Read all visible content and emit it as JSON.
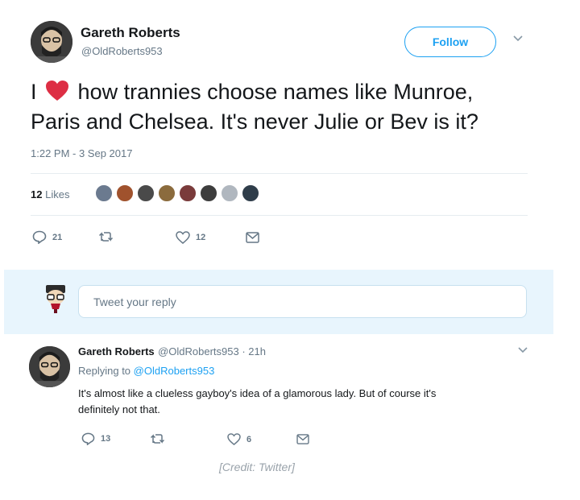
{
  "tweet": {
    "author_name": "Gareth Roberts",
    "author_handle": "@OldRoberts953",
    "follow_label": "Follow",
    "text_prefix": "I",
    "text_line1_rest": "how trannies choose names like Munroe,",
    "text_line2": "Paris and Chelsea. It's never Julie or Bev is it?",
    "timestamp": "1:22 PM - 3 Sep 2017",
    "likes_count": "12",
    "likes_label": "Likes",
    "reply_count": "21",
    "like_count_action": "12"
  },
  "composer": {
    "placeholder": "Tweet your reply"
  },
  "reply": {
    "author_name": "Gareth Roberts",
    "author_handle_time": "@OldRoberts953 · 21h",
    "replying_prefix": "Replying to",
    "replying_handle": "@OldRoberts953",
    "text_line1": "It's almost like a clueless gayboy's idea of a glamorous lady. But of course it's",
    "text_line2": "definitely not that.",
    "reply_count": "13",
    "like_count": "6"
  },
  "credit": "[Credit: Twitter]",
  "colors": {
    "accent": "#1da1f2",
    "heart": "#e0245e",
    "muted": "#657786"
  },
  "icons": [
    "reply-icon",
    "retweet-icon",
    "heart-icon",
    "dm-icon",
    "chevron-down-icon"
  ]
}
